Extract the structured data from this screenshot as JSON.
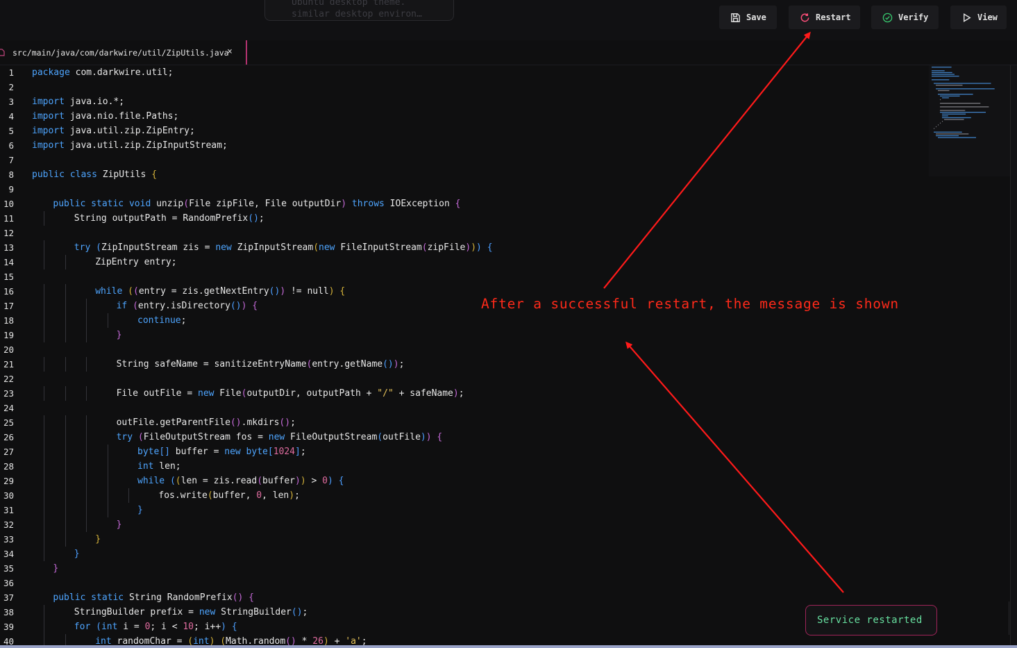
{
  "background_tooltip": {
    "lines": [
      "Ubuntu desktop theme.",
      "similar desktop environ…"
    ]
  },
  "toolbar": {
    "save_label": "Save",
    "restart_label": "Restart",
    "verify_label": "Verify",
    "view_label": "View"
  },
  "tab": {
    "path": "src/main/java/com/darkwire/util/ZipUtils.java",
    "close": "×"
  },
  "annotation": {
    "text": "After a successful restart, the message is shown",
    "color": "#ff2a1a"
  },
  "toast": {
    "text": "Service restarted",
    "color": "#67e0a0"
  },
  "colors": {
    "keyword": "#4ea5ff",
    "accent": "#b2336f",
    "verify_icon": "#36c26b",
    "restart_icon": "#ff4f7a"
  },
  "code": [
    {
      "n": "1",
      "indent": 0,
      "t": [
        [
          "kw",
          "package"
        ],
        [
          "ty",
          " com.darkwire.util;"
        ]
      ]
    },
    {
      "n": "2",
      "indent": 0,
      "t": []
    },
    {
      "n": "3",
      "indent": 0,
      "t": [
        [
          "kw",
          "import"
        ],
        [
          "ty",
          " java.io.*;"
        ]
      ]
    },
    {
      "n": "4",
      "indent": 0,
      "t": [
        [
          "kw",
          "import"
        ],
        [
          "ty",
          " java.nio.file.Paths;"
        ]
      ]
    },
    {
      "n": "5",
      "indent": 0,
      "t": [
        [
          "kw",
          "import"
        ],
        [
          "ty",
          " java.util.zip.ZipEntry;"
        ]
      ]
    },
    {
      "n": "6",
      "indent": 0,
      "t": [
        [
          "kw",
          "import"
        ],
        [
          "ty",
          " java.util.zip.ZipInputStream;"
        ]
      ]
    },
    {
      "n": "7",
      "indent": 0,
      "t": []
    },
    {
      "n": "8",
      "indent": 0,
      "t": [
        [
          "kw",
          "public class"
        ],
        [
          "ty",
          " ZipUtils "
        ],
        [
          "br",
          "{"
        ]
      ]
    },
    {
      "n": "9",
      "indent": 0,
      "t": []
    },
    {
      "n": "10",
      "indent": 1,
      "t": [
        [
          "kw",
          "public static void"
        ],
        [
          "ty",
          " unzip"
        ],
        [
          "br2",
          "("
        ],
        [
          "ty",
          "File zipFile, File outputDir"
        ],
        [
          "br2",
          ")"
        ],
        [
          "ty",
          " "
        ],
        [
          "kw",
          "throws"
        ],
        [
          "ty",
          " IOException "
        ],
        [
          "br2",
          "{"
        ]
      ]
    },
    {
      "n": "11",
      "indent": 2,
      "t": [
        [
          "ty",
          "String outputPath = RandomPrefix"
        ],
        [
          "br3",
          "()"
        ],
        [
          "ty",
          ";"
        ]
      ]
    },
    {
      "n": "12",
      "indent": 0,
      "t": []
    },
    {
      "n": "13",
      "indent": 2,
      "t": [
        [
          "kw",
          "try"
        ],
        [
          "ty",
          " "
        ],
        [
          "br3",
          "("
        ],
        [
          "ty",
          "ZipInputStream zis = "
        ],
        [
          "kw",
          "new"
        ],
        [
          "ty",
          " ZipInputStream"
        ],
        [
          "br",
          "("
        ],
        [
          "kw",
          "new"
        ],
        [
          "ty",
          " FileInputStream"
        ],
        [
          "br2",
          "("
        ],
        [
          "ty",
          "zipFile"
        ],
        [
          "br2",
          ")"
        ],
        [
          "br",
          ")"
        ],
        [
          "br3",
          ")"
        ],
        [
          "ty",
          " "
        ],
        [
          "br3",
          "{"
        ]
      ]
    },
    {
      "n": "14",
      "indent": 3,
      "t": [
        [
          "ty",
          "ZipEntry entry;"
        ]
      ]
    },
    {
      "n": "15",
      "indent": 0,
      "t": []
    },
    {
      "n": "16",
      "indent": 3,
      "t": [
        [
          "kw",
          "while"
        ],
        [
          "ty",
          " "
        ],
        [
          "br",
          "("
        ],
        [
          "br2",
          "("
        ],
        [
          "ty",
          "entry = zis.getNextEntry"
        ],
        [
          "br3",
          "()"
        ],
        [
          "br2",
          ")"
        ],
        [
          "ty",
          " != null"
        ],
        [
          "br",
          ")"
        ],
        [
          "ty",
          " "
        ],
        [
          "br",
          "{"
        ]
      ]
    },
    {
      "n": "17",
      "indent": 4,
      "t": [
        [
          "kw",
          "if"
        ],
        [
          "ty",
          " "
        ],
        [
          "br2",
          "("
        ],
        [
          "ty",
          "entry.isDirectory"
        ],
        [
          "br3",
          "()"
        ],
        [
          "br2",
          ")"
        ],
        [
          "ty",
          " "
        ],
        [
          "br2",
          "{"
        ]
      ]
    },
    {
      "n": "18",
      "indent": 5,
      "t": [
        [
          "kw",
          "continue"
        ],
        [
          "ty",
          ";"
        ]
      ]
    },
    {
      "n": "19",
      "indent": 4,
      "t": [
        [
          "br2",
          "}"
        ]
      ]
    },
    {
      "n": "20",
      "indent": 0,
      "t": []
    },
    {
      "n": "21",
      "indent": 4,
      "t": [
        [
          "ty",
          "String safeName = sanitizeEntryName"
        ],
        [
          "br2",
          "("
        ],
        [
          "ty",
          "entry.getName"
        ],
        [
          "br3",
          "()"
        ],
        [
          "br2",
          ")"
        ],
        [
          "ty",
          ";"
        ]
      ]
    },
    {
      "n": "22",
      "indent": 0,
      "t": []
    },
    {
      "n": "23",
      "indent": 4,
      "t": [
        [
          "ty",
          "File outFile = "
        ],
        [
          "kw",
          "new"
        ],
        [
          "ty",
          " File"
        ],
        [
          "br2",
          "("
        ],
        [
          "ty",
          "outputDir, outputPath + "
        ],
        [
          "str",
          "\"/\""
        ],
        [
          "ty",
          " + safeName"
        ],
        [
          "br2",
          ")"
        ],
        [
          "ty",
          ";"
        ]
      ]
    },
    {
      "n": "24",
      "indent": 0,
      "t": []
    },
    {
      "n": "25",
      "indent": 4,
      "t": [
        [
          "ty",
          "outFile.getParentFile"
        ],
        [
          "br2",
          "()"
        ],
        [
          "ty",
          ".mkdirs"
        ],
        [
          "br2",
          "()"
        ],
        [
          "ty",
          ";"
        ]
      ]
    },
    {
      "n": "26",
      "indent": 4,
      "t": [
        [
          "kw",
          "try"
        ],
        [
          "ty",
          " "
        ],
        [
          "br2",
          "("
        ],
        [
          "ty",
          "FileOutputStream fos = "
        ],
        [
          "kw",
          "new"
        ],
        [
          "ty",
          " FileOutputStream"
        ],
        [
          "br3",
          "("
        ],
        [
          "ty",
          "outFile"
        ],
        [
          "br3",
          ")"
        ],
        [
          "br2",
          ")"
        ],
        [
          "ty",
          " "
        ],
        [
          "br2",
          "{"
        ]
      ]
    },
    {
      "n": "27",
      "indent": 5,
      "t": [
        [
          "kw",
          "byte"
        ],
        [
          "br3",
          "[]"
        ],
        [
          "ty",
          " buffer = "
        ],
        [
          "kw",
          "new byte"
        ],
        [
          "br3",
          "["
        ],
        [
          "num",
          "1024"
        ],
        [
          "br3",
          "]"
        ],
        [
          "ty",
          ";"
        ]
      ]
    },
    {
      "n": "28",
      "indent": 5,
      "t": [
        [
          "kw",
          "int"
        ],
        [
          "ty",
          " len;"
        ]
      ]
    },
    {
      "n": "29",
      "indent": 5,
      "t": [
        [
          "kw",
          "while"
        ],
        [
          "ty",
          " "
        ],
        [
          "br3",
          "("
        ],
        [
          "br",
          "("
        ],
        [
          "ty",
          "len = zis.read"
        ],
        [
          "br2",
          "("
        ],
        [
          "ty",
          "buffer"
        ],
        [
          "br2",
          ")"
        ],
        [
          "br",
          ")"
        ],
        [
          "ty",
          " > "
        ],
        [
          "num",
          "0"
        ],
        [
          "br3",
          ")"
        ],
        [
          "ty",
          " "
        ],
        [
          "br3",
          "{"
        ]
      ]
    },
    {
      "n": "30",
      "indent": 6,
      "t": [
        [
          "ty",
          "fos.write"
        ],
        [
          "br",
          "("
        ],
        [
          "ty",
          "buffer, "
        ],
        [
          "num",
          "0"
        ],
        [
          "ty",
          ", len"
        ],
        [
          "br",
          ")"
        ],
        [
          "ty",
          ";"
        ]
      ]
    },
    {
      "n": "31",
      "indent": 5,
      "t": [
        [
          "br3",
          "}"
        ]
      ]
    },
    {
      "n": "32",
      "indent": 4,
      "t": [
        [
          "br2",
          "}"
        ]
      ]
    },
    {
      "n": "33",
      "indent": 3,
      "t": [
        [
          "br",
          "}"
        ]
      ]
    },
    {
      "n": "34",
      "indent": 2,
      "t": [
        [
          "br3",
          "}"
        ]
      ]
    },
    {
      "n": "35",
      "indent": 1,
      "t": [
        [
          "br2",
          "}"
        ]
      ]
    },
    {
      "n": "36",
      "indent": 0,
      "t": []
    },
    {
      "n": "37",
      "indent": 1,
      "t": [
        [
          "kw",
          "public static"
        ],
        [
          "ty",
          " String RandomPrefix"
        ],
        [
          "br2",
          "()"
        ],
        [
          "ty",
          " "
        ],
        [
          "br2",
          "{"
        ]
      ]
    },
    {
      "n": "38",
      "indent": 2,
      "t": [
        [
          "ty",
          "StringBuilder prefix = "
        ],
        [
          "kw",
          "new"
        ],
        [
          "ty",
          " StringBuilder"
        ],
        [
          "br3",
          "()"
        ],
        [
          "ty",
          ";"
        ]
      ]
    },
    {
      "n": "39",
      "indent": 2,
      "t": [
        [
          "kw",
          "for"
        ],
        [
          "ty",
          " "
        ],
        [
          "br3",
          "("
        ],
        [
          "kw",
          "int"
        ],
        [
          "ty",
          " i = "
        ],
        [
          "num",
          "0"
        ],
        [
          "ty",
          "; i < "
        ],
        [
          "num",
          "10"
        ],
        [
          "ty",
          "; i++"
        ],
        [
          "br3",
          ")"
        ],
        [
          "ty",
          " "
        ],
        [
          "br3",
          "{"
        ]
      ]
    },
    {
      "n": "40",
      "indent": 3,
      "t": [
        [
          "kw",
          "int"
        ],
        [
          "ty",
          " randomChar = "
        ],
        [
          "br",
          "("
        ],
        [
          "kw",
          "int"
        ],
        [
          "br",
          ")"
        ],
        [
          "ty",
          " "
        ],
        [
          "br",
          "("
        ],
        [
          "ty",
          "Math.random"
        ],
        [
          "br2",
          "()"
        ],
        [
          "ty",
          " * "
        ],
        [
          "num",
          "26"
        ],
        [
          "br",
          ")"
        ],
        [
          "ty",
          " + "
        ],
        [
          "str",
          "'a'"
        ],
        [
          "ty",
          ";"
        ]
      ]
    }
  ]
}
